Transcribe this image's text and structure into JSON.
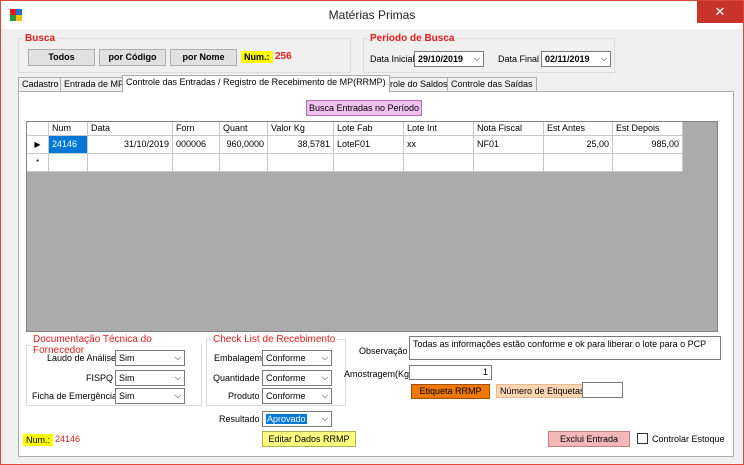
{
  "window": {
    "title": "Matérias Primas",
    "close_glyph": "✕"
  },
  "busca": {
    "legend": "Busca",
    "btn_todos": "Todos",
    "btn_codigo": "por Código",
    "btn_nome": "por Nome",
    "num_label": "Num.:",
    "num_value": "256"
  },
  "periodo": {
    "legend": "Período de Busca",
    "data_inicial_label": "Data Inicial",
    "data_inicial": "29/10/2019",
    "data_final_label": "Data Final",
    "data_final": "02/11/2019"
  },
  "tabs": [
    {
      "label": "Cadastro"
    },
    {
      "label": "Entrada de MP"
    },
    {
      "label": "Controle das Entradas / Registro de Recebimento de MP(RRMP)"
    },
    {
      "label": "Controle do Saldos"
    },
    {
      "label": "Controle das Saídas"
    }
  ],
  "panel": {
    "search_button": "Busca Entradas no Período",
    "grid": {
      "columns": [
        "Num",
        "Data",
        "Forn",
        "Quant",
        "Valor Kg",
        "Lote Fab",
        "Lote Int",
        "Nota Fiscal",
        "Est Antes",
        "Est Depois"
      ],
      "row": [
        "24146",
        "31/10/2019",
        "000006",
        "960,0000",
        "38,5781",
        "LoteF01",
        "xx",
        "NF01",
        "25,00",
        "985,00"
      ],
      "current_marker": "▶",
      "new_marker": "*"
    },
    "doc": {
      "legend": "Documentação Técnica do Fornecedor",
      "laudo_label": "Laudo de Análise",
      "laudo_value": "Sim",
      "fispq_label": "FISPQ",
      "fispq_value": "Sim",
      "ficha_label": "Ficha de Emergência",
      "ficha_value": "Sim"
    },
    "check": {
      "legend": "Check List de Recebimento",
      "embalagem_label": "Embalagem",
      "embalagem_value": "Conforme",
      "quantidade_label": "Quantidade",
      "quantidade_value": "Conforme",
      "produto_label": "Produto",
      "produto_value": "Conforme"
    },
    "observacao_label": "Observação",
    "observacao_value": "Todas as informações estão conforme e ok para liberar o lote para o PCP",
    "amostragem_label": "Amostragem(Kg)",
    "amostragem_value": "1",
    "etiqueta_button": "Etiqueta RRMP",
    "num_etiquetas_label": "Número de Etiquetas",
    "resultado_label": "Resultado",
    "resultado_value": "Aprovado",
    "editar_button": "Editar Dados RRMP",
    "exclui_button": "Exclui Entrada",
    "controlar_label": "Controlar Estoque",
    "num_label": "Num.:",
    "num_value": "24146"
  },
  "colors": {
    "accent_red": "#e21b1b",
    "highlight_yellow": "#ffff00",
    "selection_blue": "#0078d7",
    "orange": "#f07800"
  }
}
